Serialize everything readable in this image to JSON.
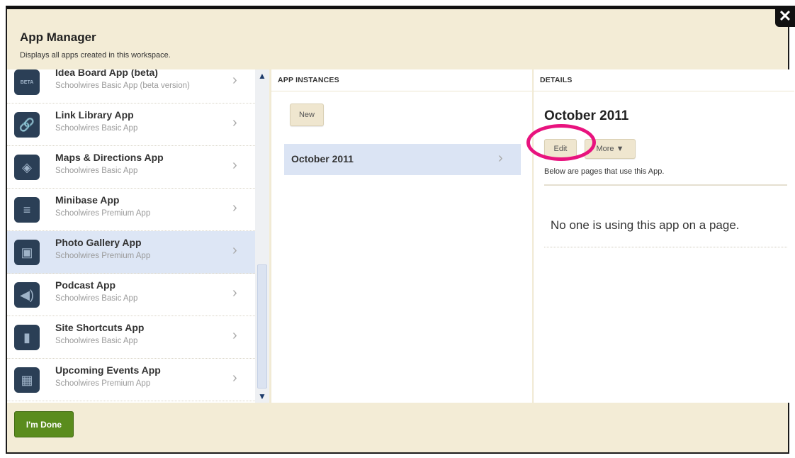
{
  "dialog": {
    "title": "App Manager",
    "subtitle": "Displays all apps created in this workspace.",
    "close_icon": "close-icon",
    "done_label": "I'm Done"
  },
  "apps": [
    {
      "name": "Idea Board App (beta)",
      "type": "Schoolwires Basic App (beta version)",
      "icon": "lightbulb-icon",
      "glyph": "BETA"
    },
    {
      "name": "Link Library App",
      "type": "Schoolwires Basic App",
      "icon": "link-icon",
      "glyph": "🔗"
    },
    {
      "name": "Maps & Directions App",
      "type": "Schoolwires Basic App",
      "icon": "compass-icon",
      "glyph": "◈"
    },
    {
      "name": "Minibase App",
      "type": "Schoolwires Premium App",
      "icon": "database-icon",
      "glyph": "≡"
    },
    {
      "name": "Photo Gallery App",
      "type": "Schoolwires Premium App",
      "icon": "camera-icon",
      "glyph": "▣",
      "selected": true
    },
    {
      "name": "Podcast App",
      "type": "Schoolwires Basic App",
      "icon": "speaker-icon",
      "glyph": "◀)"
    },
    {
      "name": "Site Shortcuts App",
      "type": "Schoolwires Basic App",
      "icon": "bookmark-icon",
      "glyph": "▮"
    },
    {
      "name": "Upcoming Events App",
      "type": "Schoolwires Premium App",
      "icon": "calendar-icon",
      "glyph": "▦"
    }
  ],
  "instances": {
    "header": "APP INSTANCES",
    "new_label": "New",
    "items": [
      {
        "label": "October 2011"
      }
    ]
  },
  "details": {
    "header": "DETAILS",
    "title": "October 2011",
    "edit_label": "Edit",
    "more_label": "More ▼",
    "description": "Below are pages that use this App.",
    "empty_text": "No one is using this app on a page."
  },
  "colors": {
    "highlight_circle": "#e8137e",
    "done_button": "#5a8c1d",
    "selected_row": "#dde6f5"
  }
}
